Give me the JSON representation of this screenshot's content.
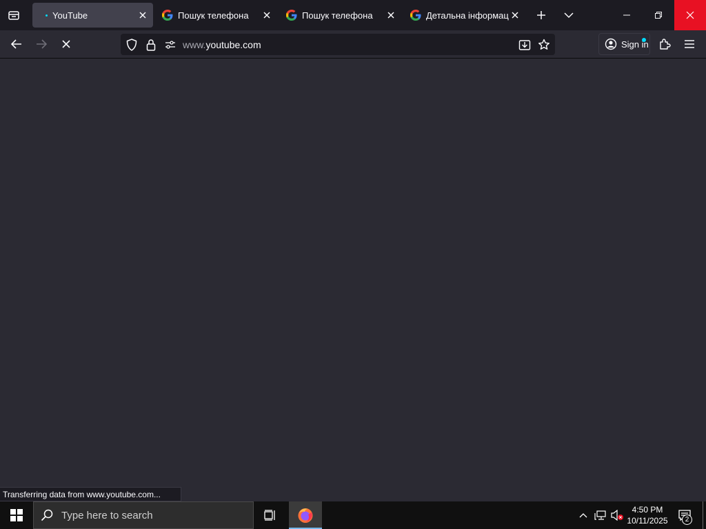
{
  "browser": {
    "tabs": [
      {
        "title": "YouTube",
        "active": true
      },
      {
        "title": "Пошук телефона",
        "active": false
      },
      {
        "title": "Пошук телефона",
        "active": false
      },
      {
        "title": "Детальна інформація",
        "active": false
      }
    ],
    "address": {
      "prefix": "www.",
      "domain": "youtube.com"
    },
    "sign_in_label": "Sign in",
    "status_text": "Transferring data from www.youtube.com..."
  },
  "taskbar": {
    "search_placeholder": "Type here to search",
    "time": "4:50 PM",
    "date": "10/11/2025",
    "notification_count": "2"
  },
  "colors": {
    "accent": "#00ddff",
    "close_red": "#e81123",
    "toolbar": "#2b2a33",
    "tabstrip": "#1c1b22"
  }
}
